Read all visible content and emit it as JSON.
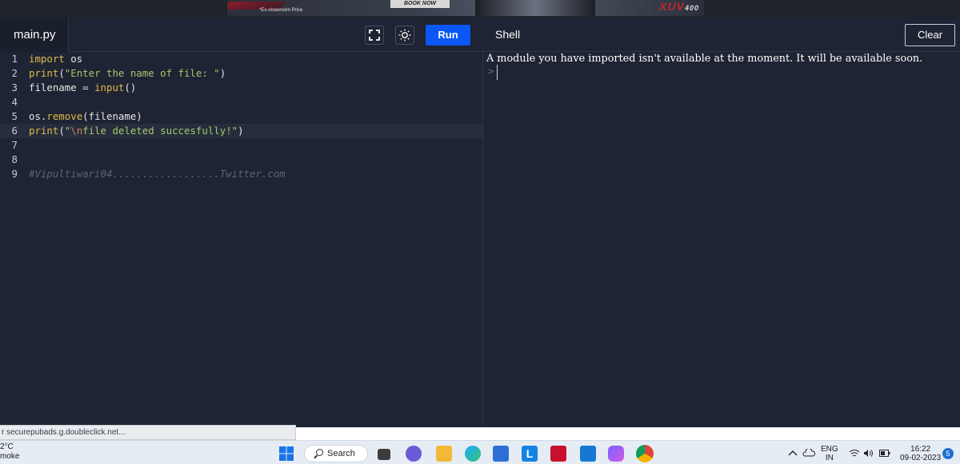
{
  "ad": {
    "price_note": "*Ex-showroom Price",
    "book_label": "BOOK NOW",
    "model_text": "XUV",
    "model_suffix": "400"
  },
  "editor": {
    "file_tab": "main.py",
    "run_label": "Run",
    "lines": [
      {
        "n": "1"
      },
      {
        "n": "2"
      },
      {
        "n": "3"
      },
      {
        "n": "4"
      },
      {
        "n": "5"
      },
      {
        "n": "6"
      },
      {
        "n": "7"
      },
      {
        "n": "8"
      },
      {
        "n": "9"
      }
    ],
    "code": {
      "l1_kw": "import",
      "l1_rest": " os",
      "l2_fn": "print",
      "l2_open": "(",
      "l2_str": "\"Enter the name of file: \"",
      "l2_close": ")",
      "l3_a": "filename = ",
      "l3_fn": "input",
      "l3_b": "()",
      "l5_a": "os.",
      "l5_fn": "remove",
      "l5_b": "(filename)",
      "l6_fn": "print",
      "l6_open": "(",
      "l6_q1": "\"",
      "l6_esc": "\\n",
      "l6_str": "file deleted succesfully!",
      "l6_q2": "\"",
      "l6_close": ")",
      "l9_comment": "#Vipultiwari04..................Twitter.com"
    }
  },
  "shell": {
    "title": "Shell",
    "clear_label": "Clear",
    "message": "A module you have imported isn't available at the moment. It will be available soon.",
    "prompt": ">"
  },
  "status": {
    "url_text": "r securepubads.g.doubleclick.net..."
  },
  "taskbar": {
    "weather_temp": "2°C",
    "weather_desc": "moke",
    "search_label": "Search",
    "lang_top": "ENG",
    "lang_bottom": "IN",
    "time": "16:22",
    "date": "09-02-2023",
    "notif_count": "5"
  },
  "colors": {
    "run_button": "#0b57f5",
    "editor_bg": "#1e2433",
    "keyword": "#e2b84e",
    "string": "#a5c76b"
  }
}
